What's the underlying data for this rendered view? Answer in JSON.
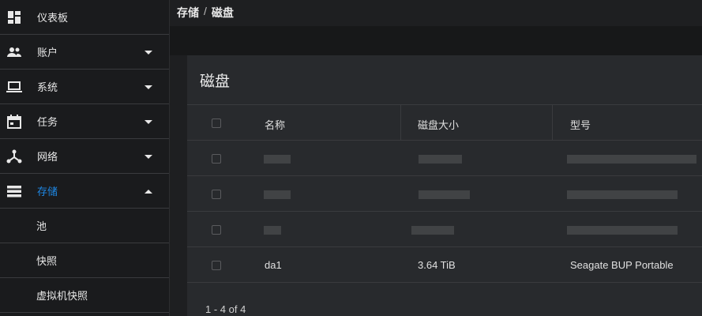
{
  "sidebar": {
    "items": [
      {
        "label": "仪表板",
        "icon": "dashboard-icon",
        "expandable": false
      },
      {
        "label": "账户",
        "icon": "users-icon",
        "expandable": true
      },
      {
        "label": "系统",
        "icon": "laptop-icon",
        "expandable": true
      },
      {
        "label": "任务",
        "icon": "calendar-icon",
        "expandable": true
      },
      {
        "label": "网络",
        "icon": "network-icon",
        "expandable": true
      },
      {
        "label": "存储",
        "icon": "storage-icon",
        "expandable": true,
        "active": true
      }
    ],
    "subitems": [
      {
        "label": "池"
      },
      {
        "label": "快照"
      },
      {
        "label": "虚拟机快照"
      }
    ]
  },
  "breadcrumb": {
    "parent": "存储",
    "separator": "/",
    "current": "磁盘"
  },
  "card": {
    "title": "磁盘",
    "columns": [
      "名称",
      "磁盘大小",
      "型号"
    ],
    "rows": [
      {
        "name": "",
        "size": "",
        "model": "",
        "redacted": true
      },
      {
        "name": "",
        "size": "",
        "model": "",
        "redacted": true
      },
      {
        "name": "",
        "size": "",
        "model": "",
        "redacted": true
      },
      {
        "name": "da1",
        "size": "3.64 TiB",
        "model": "Seagate BUP Portable",
        "redacted": false
      }
    ],
    "pagination": "1 - 4 of 4"
  },
  "colors": {
    "accent": "#1e88e5",
    "background": "#1e1f21",
    "card": "#282a2d"
  }
}
